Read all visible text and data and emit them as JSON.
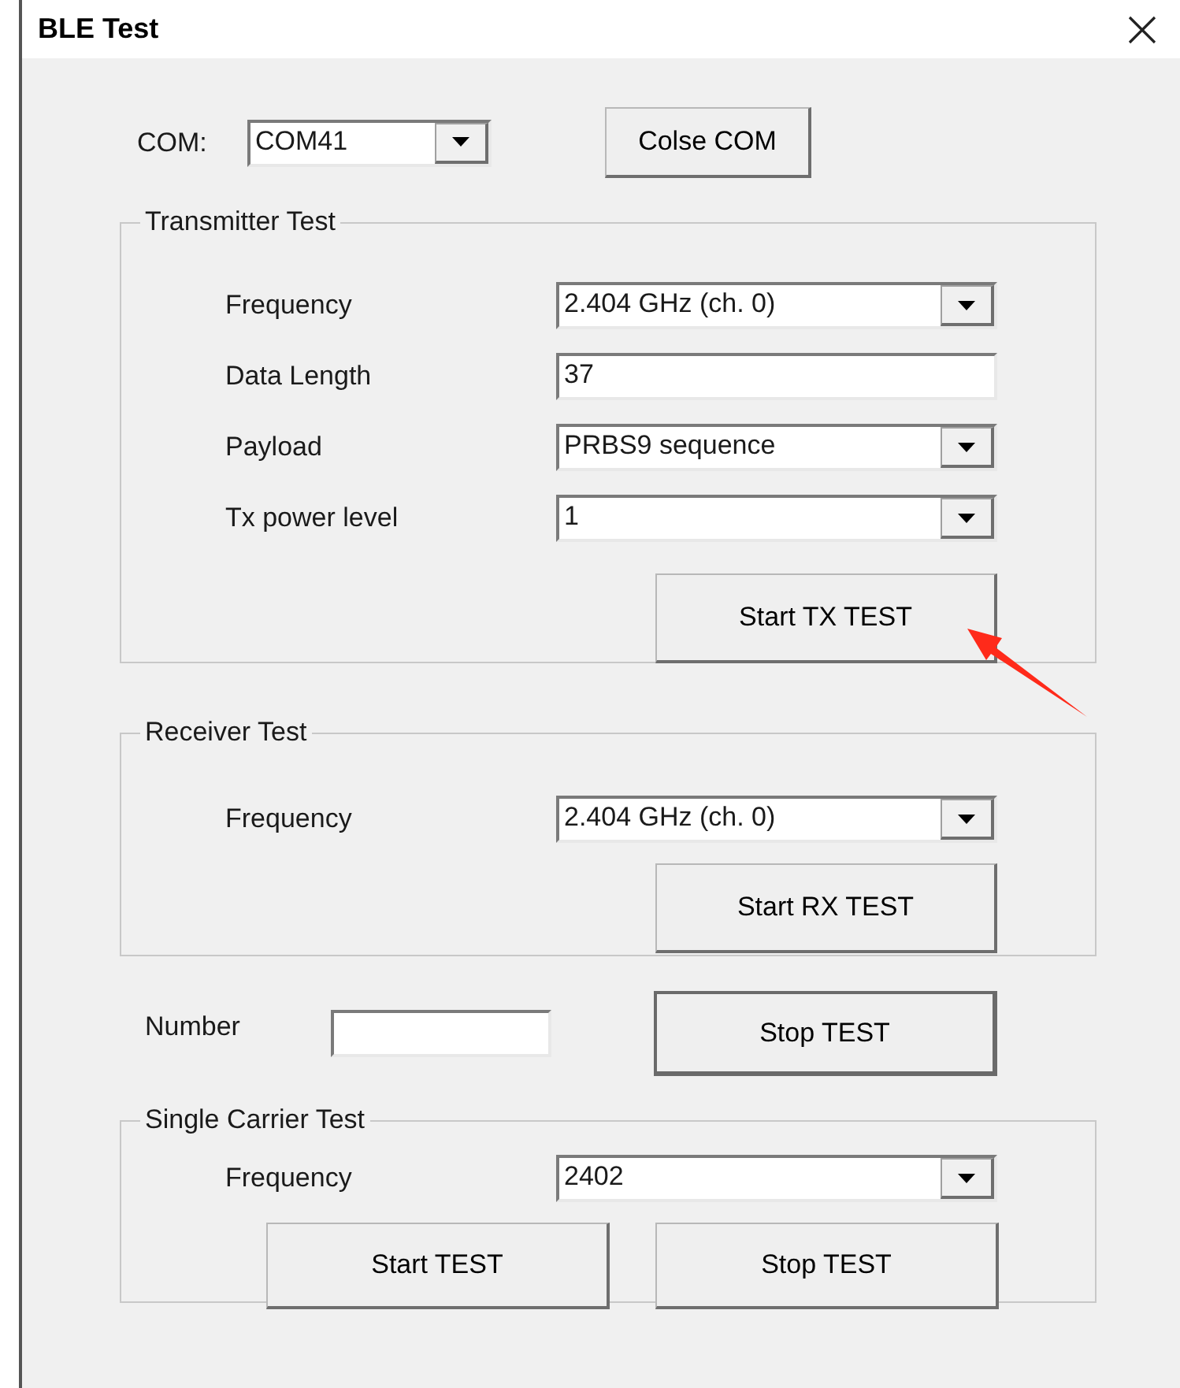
{
  "window": {
    "title": "BLE Test"
  },
  "com": {
    "label": "COM:",
    "value": "COM41",
    "button": "Colse COM"
  },
  "transmitter": {
    "title": "Transmitter Test",
    "fields": [
      {
        "kind": "combo",
        "label": "Frequency",
        "value": "2.404 GHz (ch. 0)"
      },
      {
        "kind": "text",
        "label": "Data Length",
        "value": "37"
      },
      {
        "kind": "combo",
        "label": "Payload",
        "value": "PRBS9 sequence"
      },
      {
        "kind": "combo",
        "label": "Tx power level",
        "value": "1"
      }
    ],
    "button": "Start TX TEST"
  },
  "receiver": {
    "title": "Receiver Test",
    "fields": [
      {
        "kind": "combo",
        "label": "Frequency",
        "value": "2.404 GHz (ch. 0)"
      }
    ],
    "button": "Start RX TEST"
  },
  "number": {
    "label": "Number",
    "button": {
      "label": "Stop TEST",
      "default": true
    }
  },
  "single_carrier": {
    "title": "Single Carrier Test",
    "fields": [
      {
        "kind": "combo",
        "label": "Frequency",
        "value": "2402"
      }
    ],
    "buttons": [
      "Start TEST",
      "Stop TEST"
    ]
  }
}
